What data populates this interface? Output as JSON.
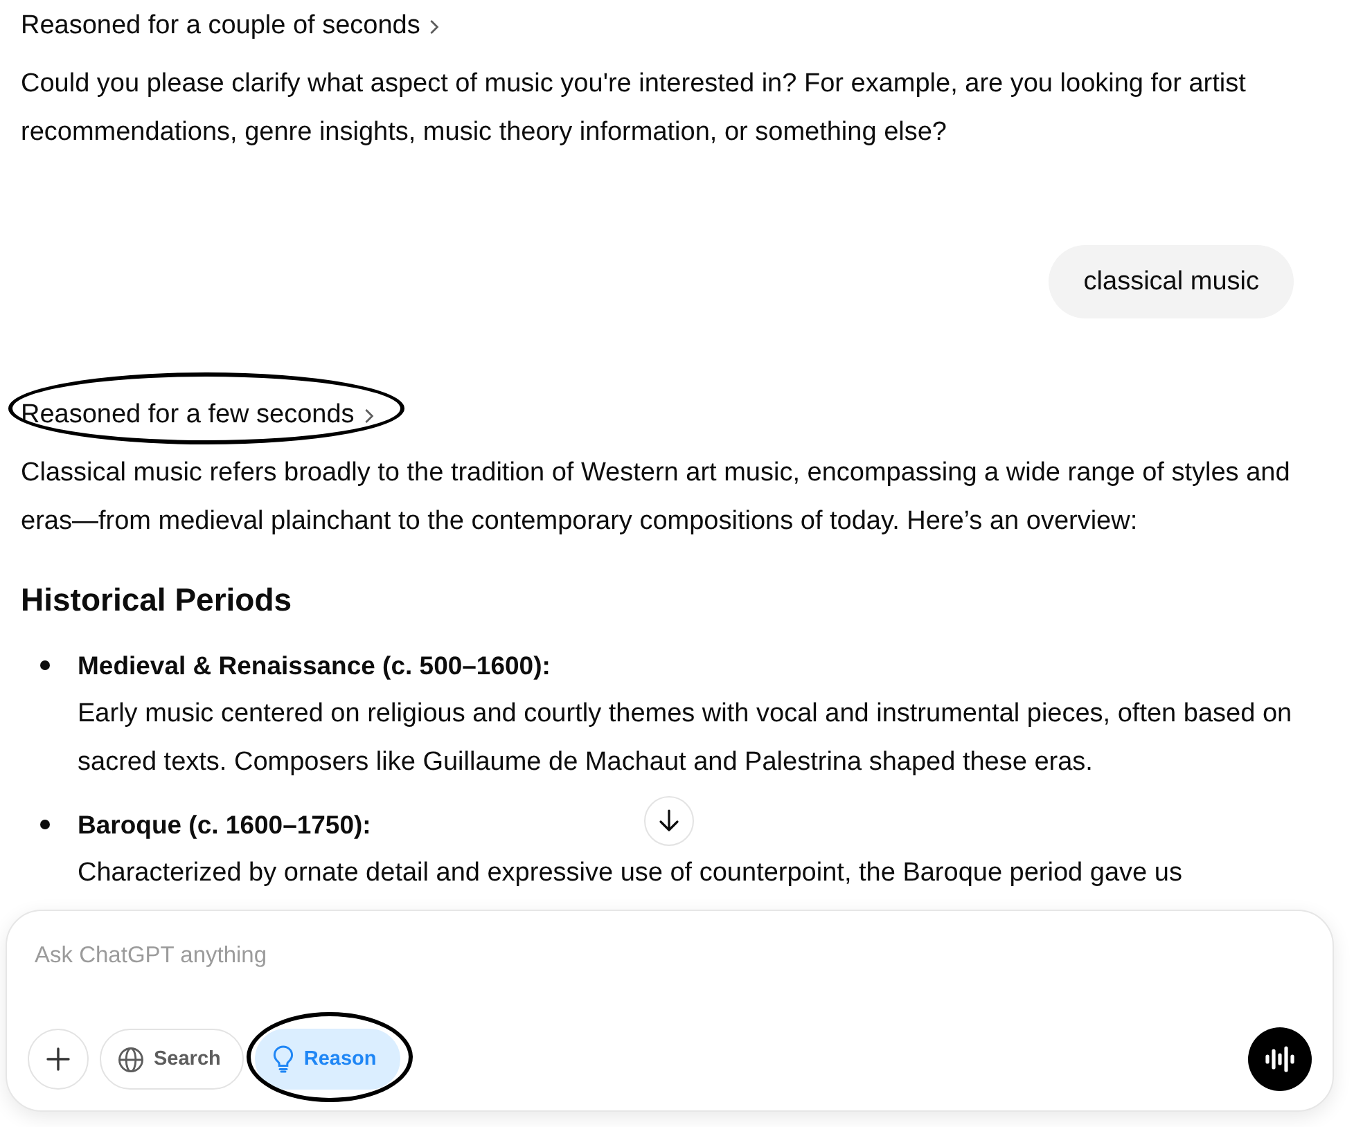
{
  "messages": [
    {
      "kind": "assistant",
      "reasoning": {
        "label": "Reasoned for a couple of seconds",
        "circled": false
      },
      "blocks": [
        {
          "kind": "paragraph",
          "text": "Could you please clarify what aspect of music you're interested in? For example, are you looking for artist recommendations, genre insights, music theory information, or something else?"
        }
      ]
    },
    {
      "kind": "user",
      "text": "classical music"
    },
    {
      "kind": "assistant",
      "reasoning": {
        "label": "Reasoned for a few seconds",
        "circled": true
      },
      "blocks": [
        {
          "kind": "paragraph",
          "text": "Classical music refers broadly to the tradition of Western art music, encompassing a wide range of styles and eras—from medieval plainchant to the contemporary compositions of today. Here’s an overview:"
        },
        {
          "kind": "heading",
          "text": "Historical Periods"
        },
        {
          "kind": "bullets",
          "items": [
            {
              "title": "Medieval & Renaissance (c. 500–1600):",
              "text": "Early music centered on religious and courtly themes with vocal and instrumental pieces, often based on sacred texts. Composers like Guillaume de Machaut and Palestrina shaped these eras."
            },
            {
              "title": "Baroque (c. 1600–1750):",
              "text": "Characterized by ornate detail and expressive use of counterpoint, the Baroque period gave us"
            }
          ]
        }
      ]
    }
  ],
  "composer": {
    "placeholder": "Ask ChatGPT anything",
    "tools": [
      {
        "kind": "add"
      },
      {
        "kind": "search",
        "label": "Search",
        "selected": false,
        "circled": false
      },
      {
        "kind": "reason",
        "label": "Reason",
        "selected": true,
        "circled": true
      }
    ]
  }
}
